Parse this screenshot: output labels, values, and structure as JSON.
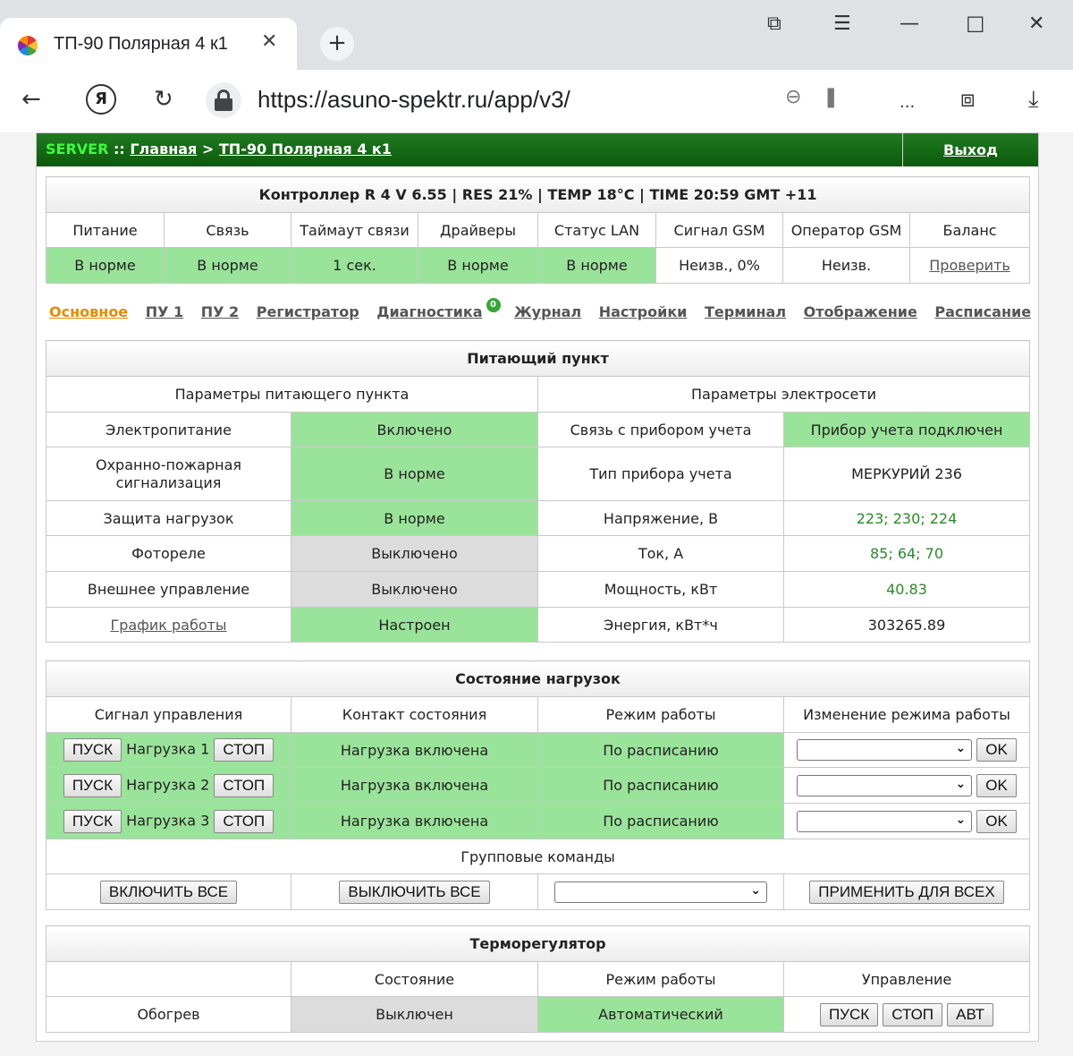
{
  "browser": {
    "tab_title": "ТП-90 Полярная 4 к1",
    "url": "https://asuno-spektr.ru/app/v3/",
    "menu_label": "..."
  },
  "header": {
    "server_label": "SERVER",
    "separator": "::",
    "home_link": "Главная",
    "arrow": ">",
    "current": "ТП-90 Полярная 4 к1",
    "logout": "Выход"
  },
  "controller": {
    "title": "Контроллер R 4 V 6.55 | RES 21% | TEMP 18°C | TIME 20:59 GMT +11",
    "columns": [
      "Питание",
      "Связь",
      "Таймаут связи",
      "Драйверы",
      "Статус LAN",
      "Сигнал GSM",
      "Оператор GSM",
      "Баланс"
    ],
    "values": [
      "В норме",
      "В норме",
      "1 сек.",
      "В норме",
      "В норме",
      "Неизв., 0%",
      "Неизв.",
      "Проверить"
    ]
  },
  "subnav": {
    "items": [
      "Основное",
      "ПУ 1",
      "ПУ 2",
      "Регистратор",
      "Диагностика",
      "Журнал",
      "Настройки",
      "Терминал",
      "Отображение",
      "Расписание"
    ],
    "diagnostics_badge": "0"
  },
  "feeder": {
    "title": "Питающий пункт",
    "left_header": "Параметры питающего пункта",
    "right_header": "Параметры электросети",
    "rows": [
      {
        "left_label": "Электропитание",
        "left_value": "Включено",
        "right_label": "Связь с прибором учета",
        "right_value": "Прибор учета подключен"
      },
      {
        "left_label": "Охранно-пожарная сигнализация",
        "left_value": "В норме",
        "right_label": "Тип прибора учета",
        "right_value": "МЕРКУРИЙ 236"
      },
      {
        "left_label": "Защита нагрузок",
        "left_value": "В норме",
        "right_label": "Напряжение, В",
        "right_value": "223; 230; 224"
      },
      {
        "left_label": "Фотореле",
        "left_value": "Выключено",
        "right_label": "Ток, А",
        "right_value": "85; 64; 70"
      },
      {
        "left_label": "Внешнее управление",
        "left_value": "Выключено",
        "right_label": "Мощность, кВт",
        "right_value": "40.83"
      },
      {
        "left_label": "График работы",
        "left_value": "Настроен",
        "right_label": "Энергия, кВт*ч",
        "right_value": "303265.89"
      }
    ]
  },
  "loads": {
    "title": "Состояние нагрузок",
    "columns": [
      "Сигнал управления",
      "Контакт состояния",
      "Режим работы",
      "Изменение режима работы"
    ],
    "start_label": "ПУСК",
    "stop_label": "СТОП",
    "ok_label": "OK",
    "rows": [
      {
        "name": "Нагрузка 1",
        "contact": "Нагрузка включена",
        "mode": "По расписанию"
      },
      {
        "name": "Нагрузка 2",
        "contact": "Нагрузка включена",
        "mode": "По расписанию"
      },
      {
        "name": "Нагрузка 3",
        "contact": "Нагрузка включена",
        "mode": "По расписанию"
      }
    ],
    "group_title": "Групповые команды",
    "all_on": "ВКЛЮЧИТЬ ВСЕ",
    "all_off": "ВЫКЛЮЧИТЬ ВСЕ",
    "apply_all": "ПРИМЕНИТЬ ДЛЯ ВСЕХ"
  },
  "thermo": {
    "title": "Терморегулятор",
    "columns": [
      "",
      "Состояние",
      "Режим работы",
      "Управление"
    ],
    "name": "Обогрев",
    "state": "Выключен",
    "mode": "Автоматический",
    "start": "ПУСК",
    "stop": "СТОП",
    "auto": "АВТ"
  },
  "colors": {
    "ok_green": "#9ae39a",
    "off_gray": "#dcdcdc",
    "nav_green": "#0c5a0c",
    "active_tab": "#e58b00",
    "value_green": "#2a8a2a"
  }
}
